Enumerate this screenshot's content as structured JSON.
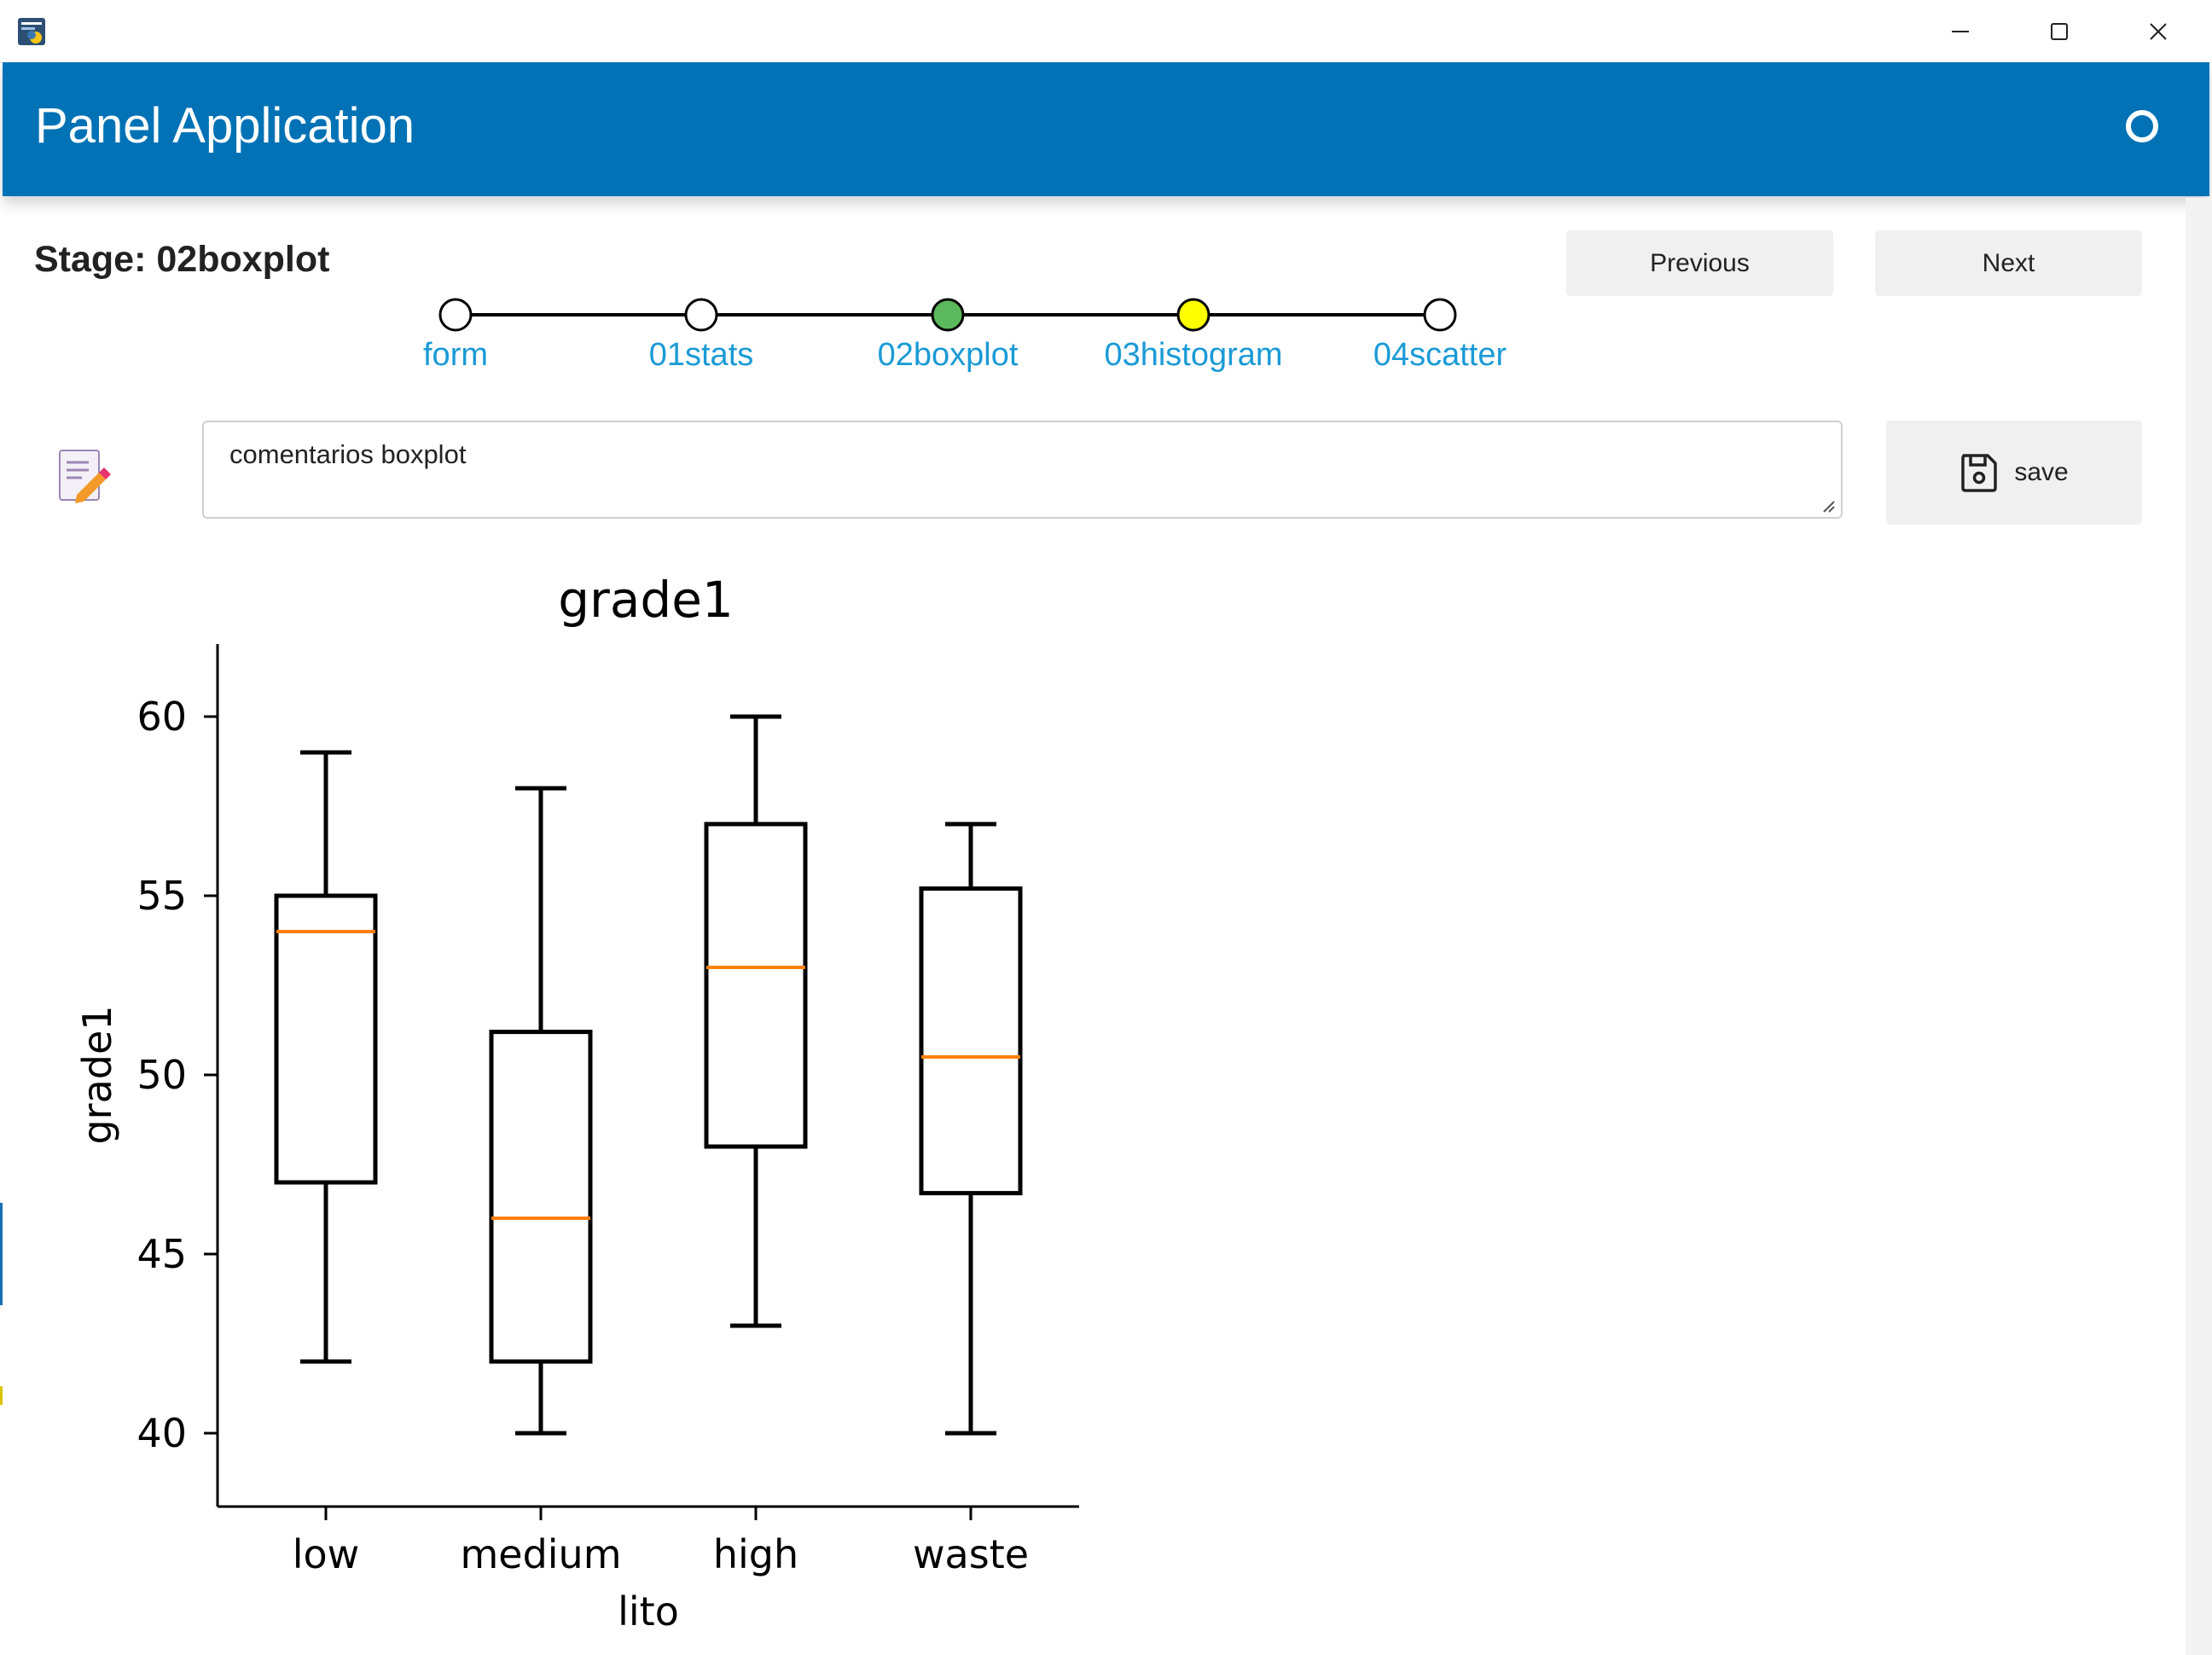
{
  "header": {
    "title": "Panel Application"
  },
  "stage": {
    "label": "Stage: 02boxplot"
  },
  "stepper": {
    "stages": [
      {
        "label": "form",
        "status": "inactive",
        "color": "#ffffff"
      },
      {
        "label": "01stats",
        "status": "inactive",
        "color": "#ffffff"
      },
      {
        "label": "02boxplot",
        "status": "current",
        "color": "#5cb85c"
      },
      {
        "label": "03histogram",
        "status": "next",
        "color": "#ffff00"
      },
      {
        "label": "04scatter",
        "status": "inactive",
        "color": "#ffffff"
      }
    ],
    "label_color": "#1a9ad6"
  },
  "nav": {
    "previous_label": "Previous",
    "next_label": "Next"
  },
  "notes": {
    "text": "comentarios boxplot",
    "save_label": "save"
  },
  "colors": {
    "header_bg": "#0072b5",
    "button_bg": "#f0f0f0",
    "median": "#ff7f0e"
  },
  "chart_data": {
    "type": "boxplot",
    "title": "grade1",
    "xlabel": "lito",
    "ylabel": "grade1",
    "categories": [
      "low",
      "medium",
      "high",
      "waste"
    ],
    "boxes": [
      {
        "name": "low",
        "whislo": 42,
        "q1": 47,
        "med": 54,
        "q3": 55,
        "whishi": 59
      },
      {
        "name": "medium",
        "whislo": 40,
        "q1": 42,
        "med": 46,
        "q3": 51.2,
        "whishi": 58
      },
      {
        "name": "high",
        "whislo": 43,
        "q1": 48,
        "med": 53,
        "q3": 57,
        "whishi": 60
      },
      {
        "name": "waste",
        "whislo": 40,
        "q1": 46.7,
        "med": 50.5,
        "q3": 55.2,
        "whishi": 57
      }
    ],
    "yticks": [
      40,
      45,
      50,
      55,
      60
    ],
    "ylim": [
      38,
      62
    ],
    "grid": false
  }
}
